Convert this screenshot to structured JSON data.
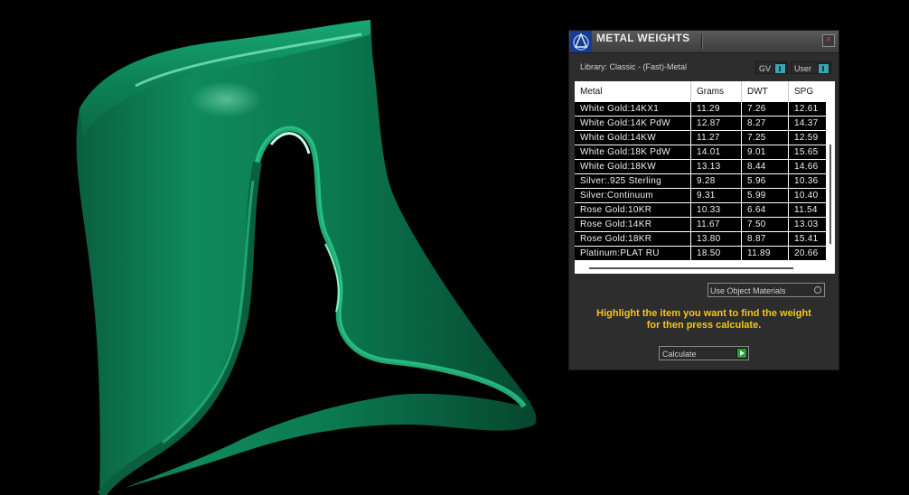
{
  "panel": {
    "title": "METAL WEIGHTS",
    "close_symbol": "×",
    "library_label": "Library: Classic - (Fast)-Metal",
    "toggle_gv": "GV",
    "toggle_user": "User",
    "use_object_materials": "Use Object Materials",
    "instruction_line1": "Highlight the item you want to find the weight",
    "instruction_line2": "for then press calculate.",
    "calculate_label": "Calculate",
    "icons": [
      "logo-icon",
      "close-icon",
      "toggle-icon",
      "radio-icon",
      "play-arrow-icon"
    ]
  },
  "table": {
    "headers": [
      "Metal",
      "Grams",
      "DWT",
      "SPG"
    ],
    "rows": [
      [
        "White Gold:14KX1",
        "11.29",
        "7.26",
        "12.61"
      ],
      [
        "White Gold:14K PdW",
        "12.87",
        "8.27",
        "14.37"
      ],
      [
        "White Gold:14KW",
        "11.27",
        "7.25",
        "12.59"
      ],
      [
        "White Gold:18K PdW",
        "14.01",
        "9.01",
        "15.65"
      ],
      [
        "White Gold:18KW",
        "13.13",
        "8.44",
        "14.66"
      ],
      [
        "Silver:.925 Sterling",
        "9.28",
        "5.96",
        "10.36"
      ],
      [
        "Silver:Continuum",
        "9.31",
        "5.99",
        "10.40"
      ],
      [
        "Rose Gold:10KR",
        "10.33",
        "6.64",
        "11.54"
      ],
      [
        "Rose Gold:14KR",
        "11.67",
        "7.50",
        "13.03"
      ],
      [
        "Rose Gold:18KR",
        "13.80",
        "8.87",
        "15.41"
      ],
      [
        "Platinum:PLAT RU",
        "18.50",
        "11.89",
        "20.66"
      ]
    ]
  },
  "colors": {
    "panel_bg": "#2d2d2d",
    "accent_toggle": "#3aa6b0",
    "instruction_text": "#f2c61a",
    "calculate_arrow": "#2e9a3a",
    "model_green": "#0f8a5c"
  }
}
